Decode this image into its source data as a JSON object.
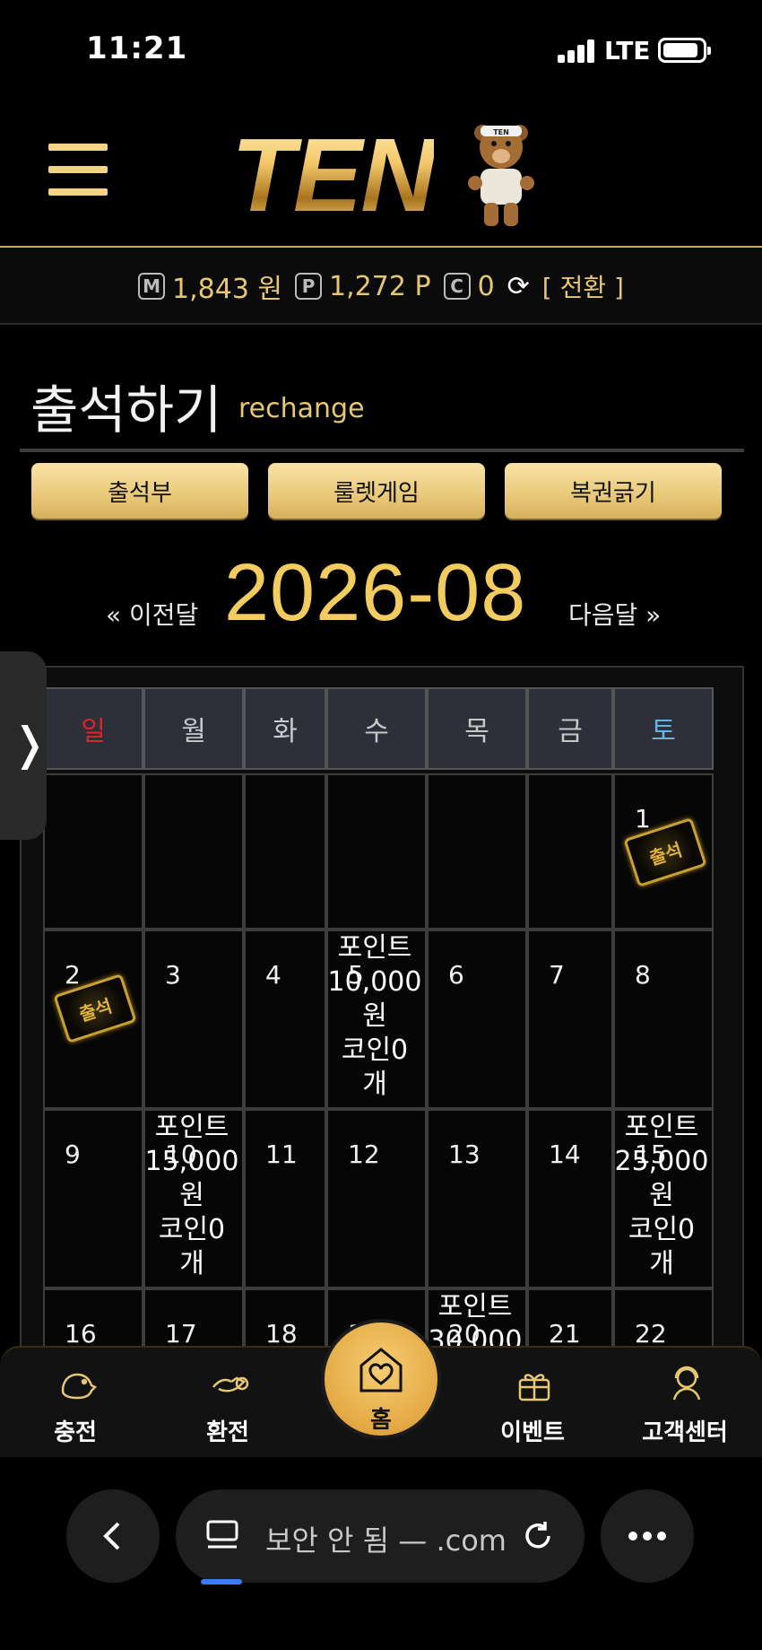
{
  "status_bar": {
    "time": "11:21",
    "network": "LTE"
  },
  "header": {
    "logo_text": "TEN",
    "bear_badge": "TEN"
  },
  "balance": {
    "money_icon": "M",
    "money": "1,843 원",
    "point_icon": "P",
    "points": "1,272 P",
    "coin_icon": "C",
    "coins": "0",
    "refresh_icon": "⟳",
    "swap_label": "[ 전환 ]"
  },
  "page": {
    "title": "출석하기",
    "subtitle": "rechange"
  },
  "tabs": [
    "출석부",
    "룰렛게임",
    "복권긁기"
  ],
  "month_nav": {
    "prev": "« 이전달",
    "current": "2026-08",
    "next": "다음달 »"
  },
  "calendar": {
    "weekdays": [
      "일",
      "월",
      "화",
      "수",
      "목",
      "금",
      "토"
    ],
    "weekday_colors": [
      "#d8262b",
      "#c9c9c9",
      "#c9c9c9",
      "#c9c9c9",
      "#c9c9c9",
      "#c9c9c9",
      "#62b4e8"
    ],
    "stamp_text": "출석",
    "cells": [
      {
        "day": ""
      },
      {
        "day": ""
      },
      {
        "day": ""
      },
      {
        "day": ""
      },
      {
        "day": ""
      },
      {
        "day": ""
      },
      {
        "day": "1",
        "stamp": true
      },
      {
        "day": "2",
        "stamp": true
      },
      {
        "day": "3"
      },
      {
        "day": "4"
      },
      {
        "day": "5",
        "reward": [
          "포인트",
          "10,000",
          "원",
          "코인0",
          "개"
        ]
      },
      {
        "day": "6"
      },
      {
        "day": "7"
      },
      {
        "day": "8"
      },
      {
        "day": "9"
      },
      {
        "day": "10",
        "reward": [
          "포인트",
          "15,000",
          "원",
          "코인0",
          "개"
        ]
      },
      {
        "day": "11"
      },
      {
        "day": "12"
      },
      {
        "day": "13"
      },
      {
        "day": "14"
      },
      {
        "day": "15",
        "reward": [
          "포인트",
          "25,000",
          "원",
          "코인0",
          "개"
        ]
      },
      {
        "day": "16"
      },
      {
        "day": "17"
      },
      {
        "day": "18"
      },
      {
        "day": "19"
      },
      {
        "day": "20",
        "reward": [
          "포인트",
          "30,000"
        ]
      },
      {
        "day": "21"
      },
      {
        "day": "22"
      }
    ]
  },
  "bottom_nav": {
    "items": [
      {
        "label": "충전",
        "icon": "charge-icon"
      },
      {
        "label": "환전",
        "icon": "exchange-icon"
      },
      {
        "label": "이벤트",
        "icon": "gift-icon"
      },
      {
        "label": "고객센터",
        "icon": "headset-icon"
      }
    ],
    "home_label": "홈"
  },
  "browser": {
    "url_text": "보안 안 됨 — .com"
  }
}
